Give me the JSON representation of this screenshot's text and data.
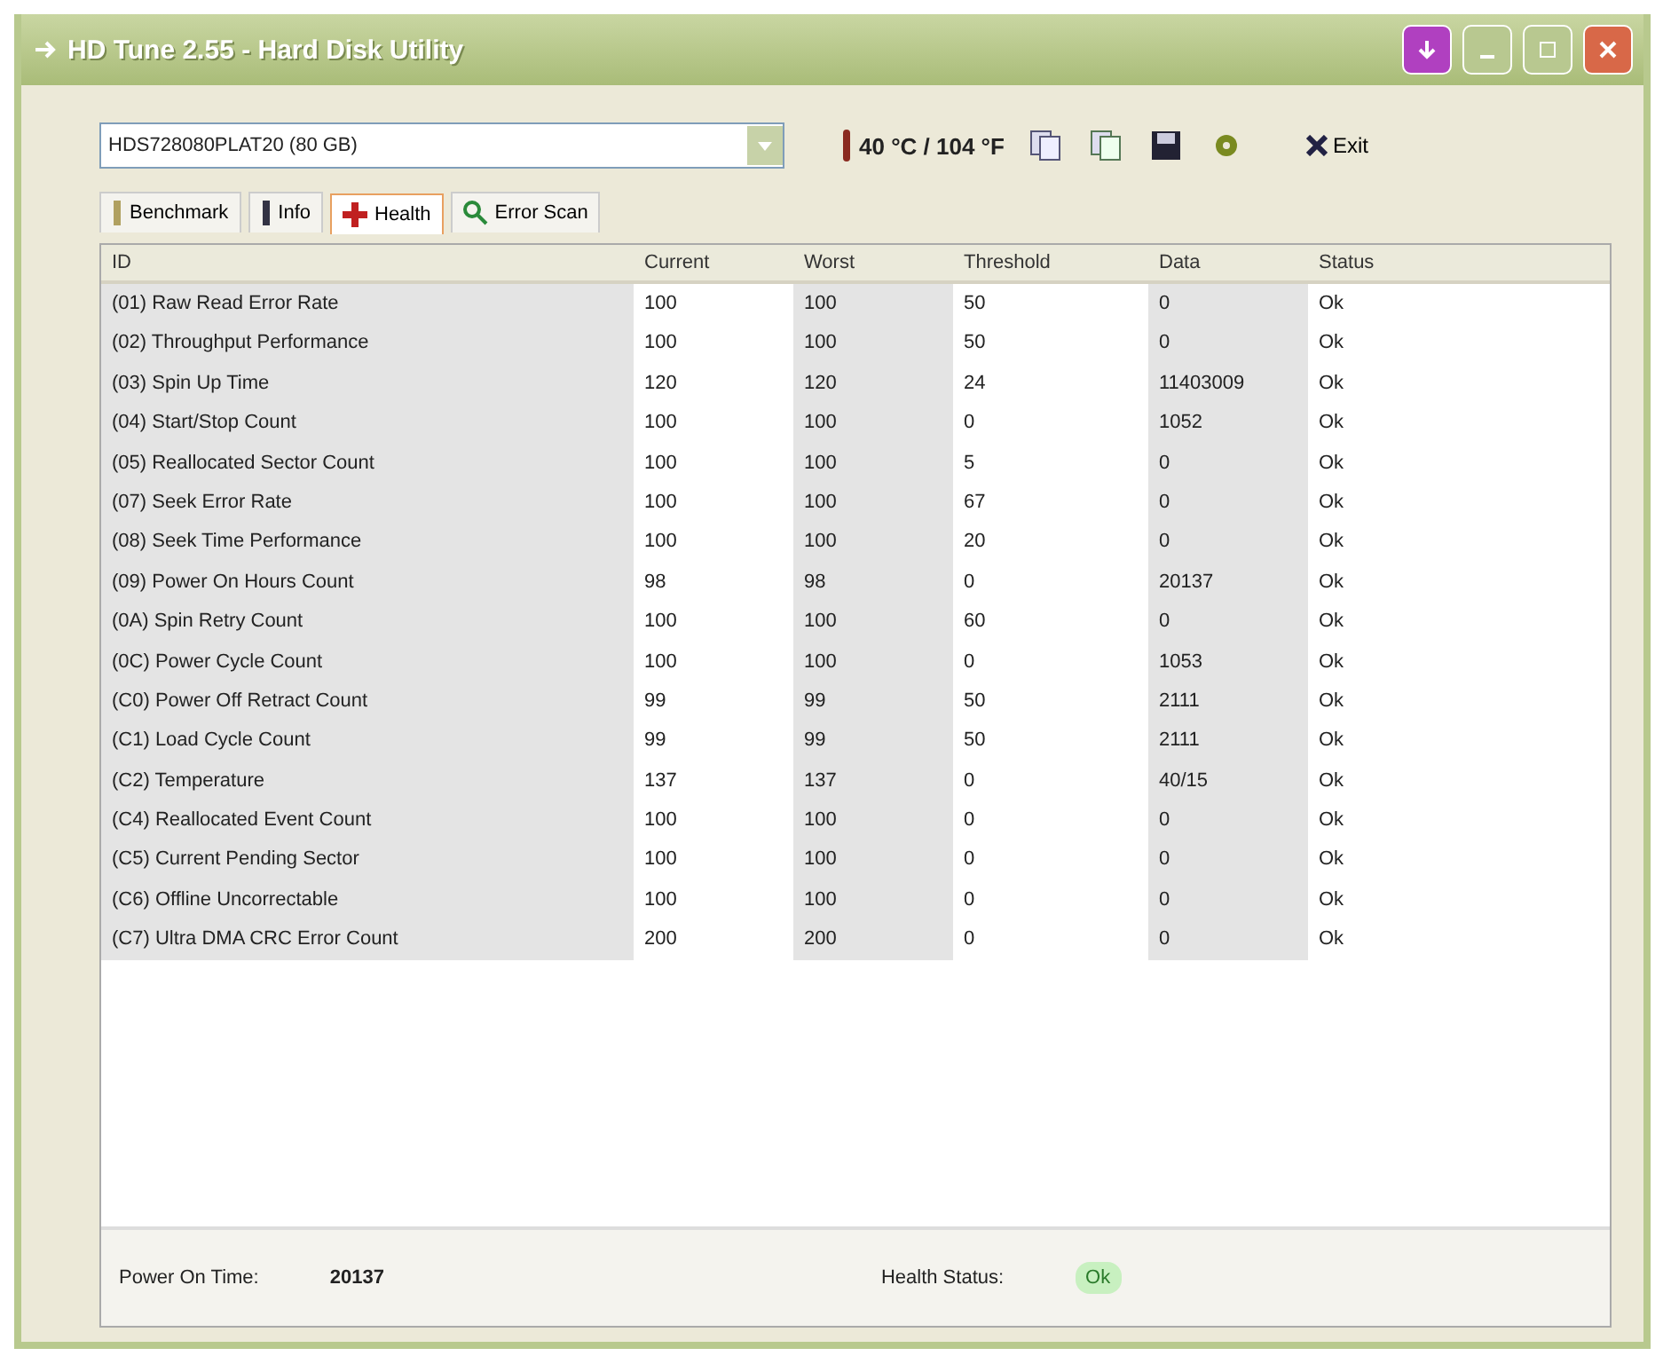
{
  "window": {
    "title": "HD Tune 2.55 - Hard Disk Utility"
  },
  "toolbar": {
    "drive": "HDS728080PLAT20 (80 GB)",
    "temperature": "40 °C / 104 °F",
    "exit": "Exit"
  },
  "tabs": [
    {
      "label": "Benchmark",
      "selected": false
    },
    {
      "label": "Info",
      "selected": false
    },
    {
      "label": "Health",
      "selected": true
    },
    {
      "label": "Error Scan",
      "selected": false
    }
  ],
  "table": {
    "columns": [
      "ID",
      "Current",
      "Worst",
      "Threshold",
      "Data",
      "Status"
    ],
    "rows": [
      [
        "(01) Raw Read Error Rate",
        "100",
        "100",
        "50",
        "0",
        "Ok"
      ],
      [
        "(02) Throughput Performance",
        "100",
        "100",
        "50",
        "0",
        "Ok"
      ],
      [
        "(03) Spin Up Time",
        "120",
        "120",
        "24",
        "11403009",
        "Ok"
      ],
      [
        "(04) Start/Stop Count",
        "100",
        "100",
        "0",
        "1052",
        "Ok"
      ],
      [
        "(05) Reallocated Sector Count",
        "100",
        "100",
        "5",
        "0",
        "Ok"
      ],
      [
        "(07) Seek Error Rate",
        "100",
        "100",
        "67",
        "0",
        "Ok"
      ],
      [
        "(08) Seek Time Performance",
        "100",
        "100",
        "20",
        "0",
        "Ok"
      ],
      [
        "(09) Power On Hours Count",
        "98",
        "98",
        "0",
        "20137",
        "Ok"
      ],
      [
        "(0A) Spin Retry Count",
        "100",
        "100",
        "60",
        "0",
        "Ok"
      ],
      [
        "(0C) Power Cycle Count",
        "100",
        "100",
        "0",
        "1053",
        "Ok"
      ],
      [
        "(C0) Power Off Retract Count",
        "99",
        "99",
        "50",
        "2111",
        "Ok"
      ],
      [
        "(C1) Load Cycle Count",
        "99",
        "99",
        "50",
        "2111",
        "Ok"
      ],
      [
        "(C2) Temperature",
        "137",
        "137",
        "0",
        "40/15",
        "Ok"
      ],
      [
        "(C4) Reallocated Event Count",
        "100",
        "100",
        "0",
        "0",
        "Ok"
      ],
      [
        "(C5) Current Pending Sector",
        "100",
        "100",
        "0",
        "0",
        "Ok"
      ],
      [
        "(C6) Offline Uncorrectable",
        "100",
        "100",
        "0",
        "0",
        "Ok"
      ],
      [
        "(C7) Ultra DMA CRC Error Count",
        "200",
        "200",
        "0",
        "0",
        "Ok"
      ]
    ]
  },
  "footer": {
    "power_on_label": "Power On Time:",
    "power_on_value": "20137",
    "health_label": "Health Status:",
    "health_value": "Ok"
  }
}
